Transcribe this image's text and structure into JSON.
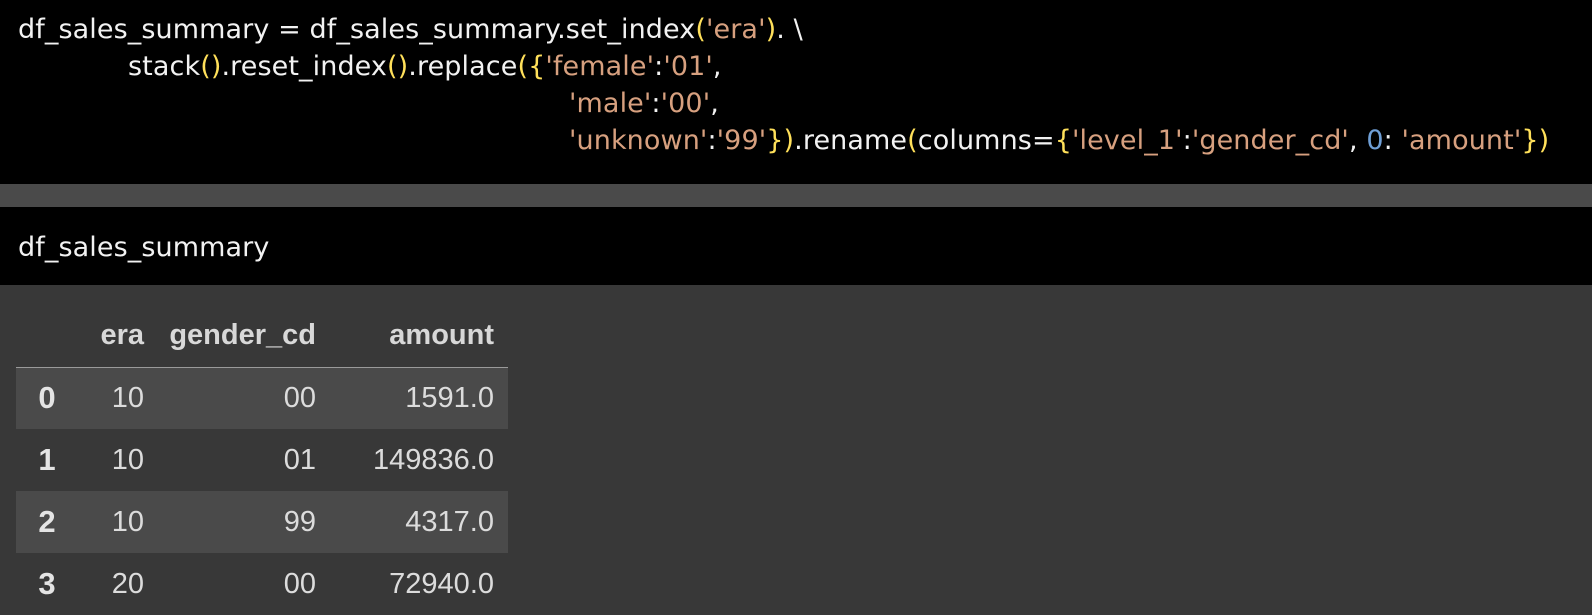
{
  "cell_code": {
    "lines": [
      [
        {
          "t": "df_sales_summary = df_sales_summary.set_index",
          "k": "pln"
        },
        {
          "t": "(",
          "k": "par"
        },
        {
          "t": "'era'",
          "k": "str"
        },
        {
          "t": ")",
          "k": "par"
        },
        {
          "t": ". \\",
          "k": "pln"
        }
      ],
      [
        {
          "t": "stack",
          "k": "pln"
        },
        {
          "t": "()",
          "k": "par"
        },
        {
          "t": ".reset_index",
          "k": "pln"
        },
        {
          "t": "()",
          "k": "par"
        },
        {
          "t": ".replace",
          "k": "pln"
        },
        {
          "t": "({",
          "k": "par"
        },
        {
          "t": "'female'",
          "k": "str"
        },
        {
          "t": ":",
          "k": "pln"
        },
        {
          "t": "'01'",
          "k": "str"
        },
        {
          "t": ",",
          "k": "pln"
        }
      ],
      [
        {
          "t": "'male'",
          "k": "str"
        },
        {
          "t": ":",
          "k": "pln"
        },
        {
          "t": "'00'",
          "k": "str"
        },
        {
          "t": ",",
          "k": "pln"
        }
      ],
      [
        {
          "t": "'unknown'",
          "k": "str"
        },
        {
          "t": ":",
          "k": "pln"
        },
        {
          "t": "'99'",
          "k": "str"
        },
        {
          "t": "})",
          "k": "par"
        },
        {
          "t": ".rename",
          "k": "pln"
        },
        {
          "t": "(",
          "k": "par"
        },
        {
          "t": "columns=",
          "k": "pln"
        },
        {
          "t": "{",
          "k": "par"
        },
        {
          "t": "'level_1'",
          "k": "str"
        },
        {
          "t": ":",
          "k": "pln"
        },
        {
          "t": "'gender_cd'",
          "k": "str"
        },
        {
          "t": ", ",
          "k": "pln"
        },
        {
          "t": "0",
          "k": "num"
        },
        {
          "t": ": ",
          "k": "pln"
        },
        {
          "t": "'amount'",
          "k": "str"
        },
        {
          "t": "})",
          "k": "par"
        }
      ]
    ]
  },
  "cell_display": {
    "code": "df_sales_summary"
  },
  "dataframe": {
    "columns": [
      "",
      "era",
      "gender_cd",
      "amount"
    ],
    "rows": [
      {
        "index": "0",
        "era": "10",
        "gender_cd": "00",
        "amount": "1591.0"
      },
      {
        "index": "1",
        "era": "10",
        "gender_cd": "01",
        "amount": "149836.0"
      },
      {
        "index": "2",
        "era": "10",
        "gender_cd": "99",
        "amount": "4317.0"
      },
      {
        "index": "3",
        "era": "20",
        "gender_cd": "00",
        "amount": "72940.0"
      }
    ]
  },
  "colors": {
    "code_background": "#000000",
    "output_background": "#383838",
    "string": "#d7a07f",
    "number": "#6f9fd6",
    "bracket": "#ffe05a",
    "plain": "#f2f2f2"
  }
}
